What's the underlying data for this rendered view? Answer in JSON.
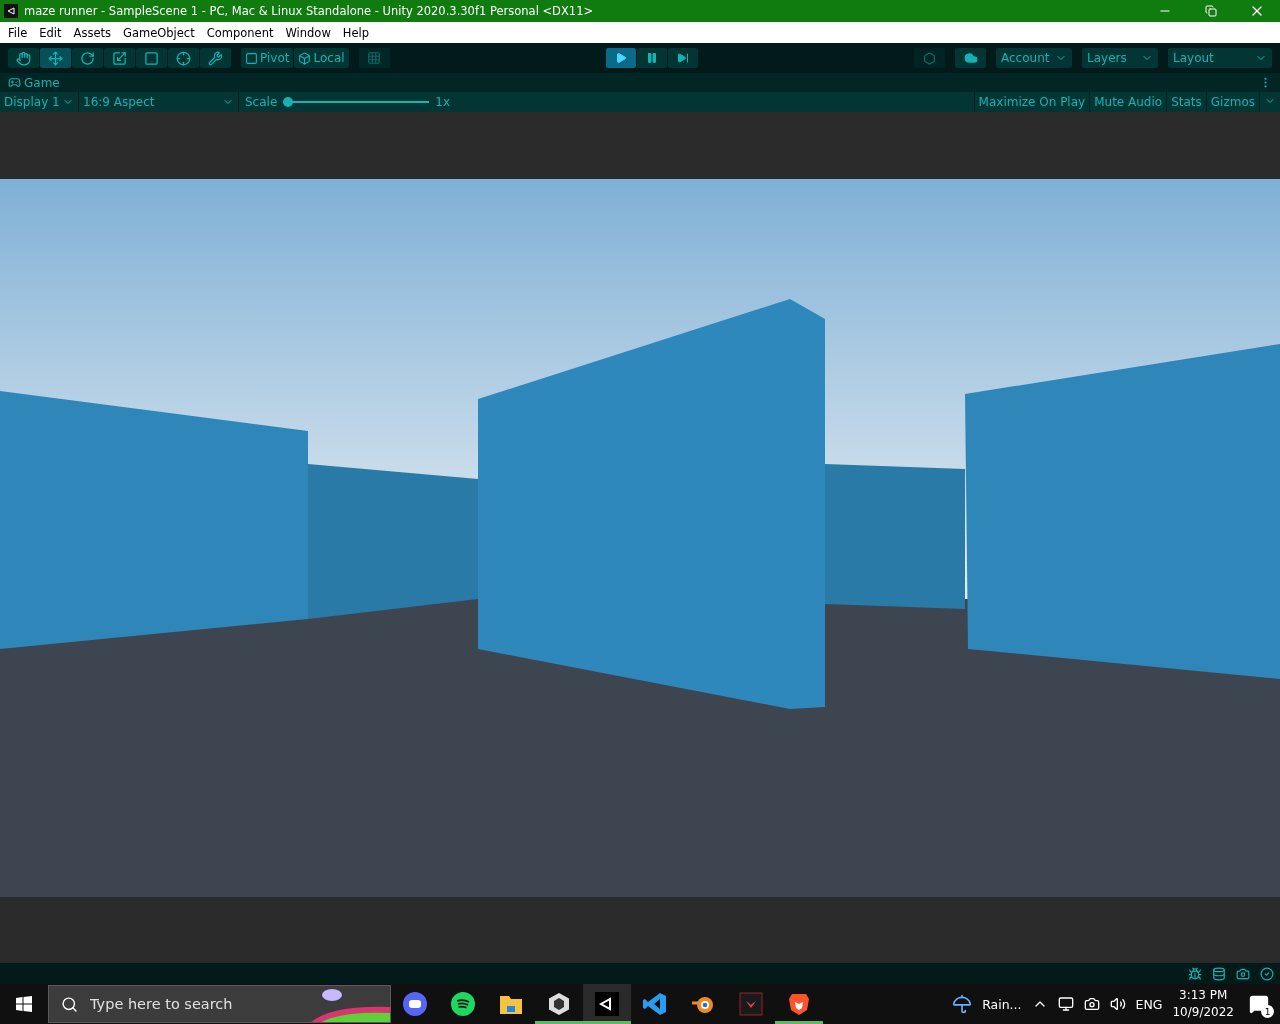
{
  "window": {
    "title": "maze runner - SampleScene 1 - PC, Mac & Linux Standalone - Unity 2020.3.30f1 Personal <DX11>"
  },
  "menu": [
    "File",
    "Edit",
    "Assets",
    "GameObject",
    "Component",
    "Window",
    "Help"
  ],
  "tools": [
    {
      "selected": false
    },
    {
      "selected": true
    },
    {
      "selected": false
    },
    {
      "selected": false
    },
    {
      "selected": false
    },
    {
      "selected": false
    },
    {
      "selected": false
    }
  ],
  "handle_buttons": [
    "Pivot",
    "Local"
  ],
  "play_controls": [
    {
      "selected": true
    },
    {
      "selected": false
    },
    {
      "selected": false
    }
  ],
  "dropdowns": [
    "Account",
    "Layers",
    "Layout"
  ],
  "game_tab": {
    "label": "Game"
  },
  "game_toolbar": {
    "display": "Display 1",
    "aspect": "16:9 Aspect",
    "scale_label": "Scale",
    "scale": {
      "level": 0.0
    },
    "scale_reading": "1x",
    "toggles": [
      "Maximize On Play",
      "Mute Audio",
      "Stats",
      "Gizmos"
    ]
  },
  "taskbar": {
    "search": {
      "placeholder": "Type here to search"
    },
    "apps": [
      {
        "running": false,
        "active": false
      },
      {
        "running": false,
        "active": false
      },
      {
        "running": false,
        "active": false
      },
      {
        "running": true,
        "active": false
      },
      {
        "running": true,
        "active": true
      },
      {
        "running": false,
        "active": false
      },
      {
        "running": false,
        "active": false
      },
      {
        "running": false,
        "active": false
      },
      {
        "running": true,
        "active": false
      }
    ],
    "weather": "Rain...",
    "language": "ENG",
    "time": "3:13 PM",
    "date": "10/9/2022",
    "notifications": "1"
  }
}
